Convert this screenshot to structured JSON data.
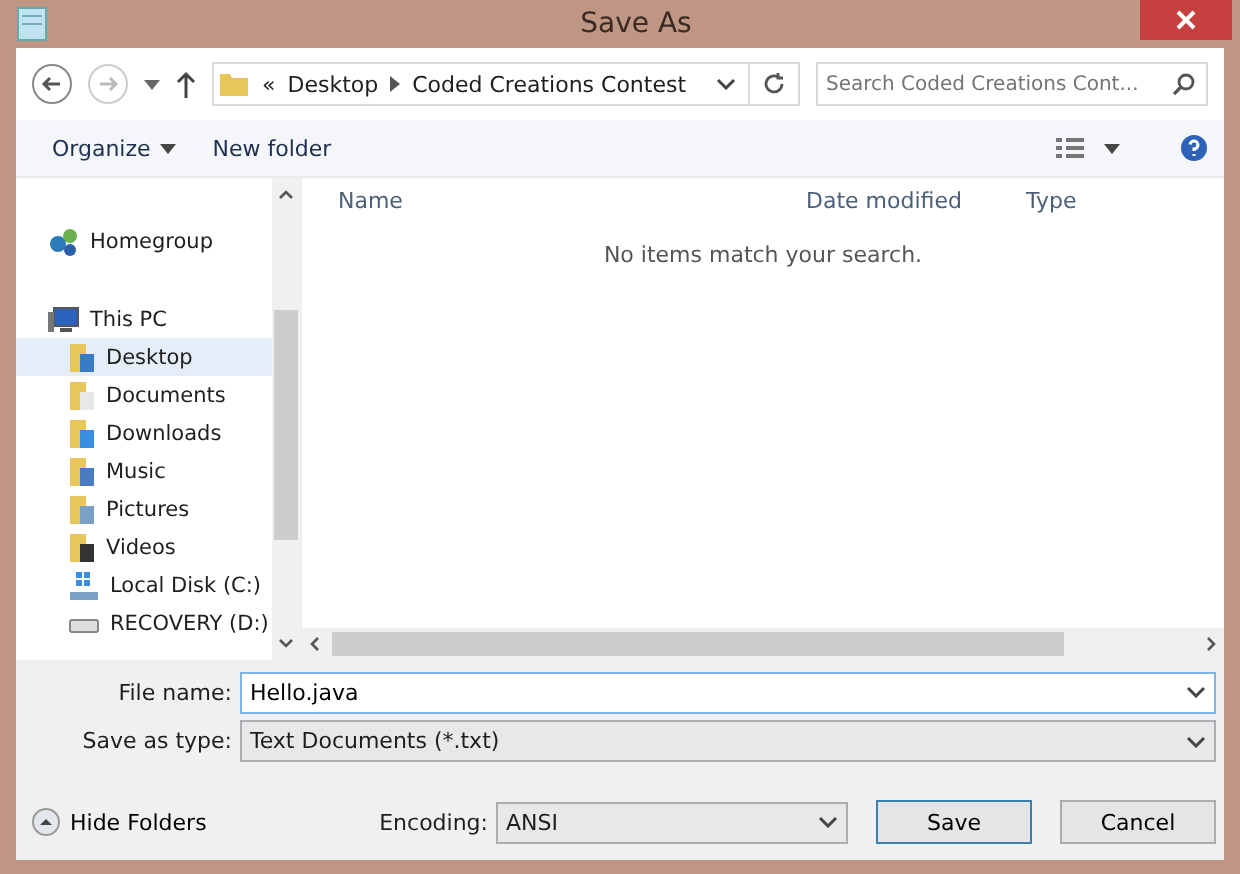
{
  "window": {
    "title": "Save As"
  },
  "address": {
    "path": [
      {
        "label": "Desktop"
      },
      {
        "label": "Coded Creations Contest"
      }
    ],
    "overflow": "«"
  },
  "search": {
    "placeholder": "Search Coded Creations Cont..."
  },
  "toolbar": {
    "organize": "Organize",
    "new_folder": "New folder"
  },
  "sidebar": {
    "items": [
      {
        "label": "Homegroup",
        "selected": false
      },
      {
        "label": "This PC",
        "selected": false,
        "children": [
          {
            "label": "Desktop",
            "selected": true
          },
          {
            "label": "Documents",
            "selected": false
          },
          {
            "label": "Downloads",
            "selected": false
          },
          {
            "label": "Music",
            "selected": false
          },
          {
            "label": "Pictures",
            "selected": false
          },
          {
            "label": "Videos",
            "selected": false
          },
          {
            "label": "Local Disk (C:)",
            "selected": false
          },
          {
            "label": "RECOVERY (D:)",
            "selected": false
          }
        ]
      }
    ]
  },
  "table": {
    "columns": [
      "Name",
      "Date modified",
      "Type"
    ],
    "empty_message": "No items match your search."
  },
  "form": {
    "file_name_label": "File name:",
    "file_name": "Hello.java",
    "type_label": "Save as type:",
    "type": "Text Documents (*.txt)"
  },
  "footer": {
    "hide_folders": "Hide Folders",
    "encoding_label": "Encoding:",
    "encoding": "ANSI",
    "buttons": [
      "Save",
      "Cancel"
    ]
  }
}
